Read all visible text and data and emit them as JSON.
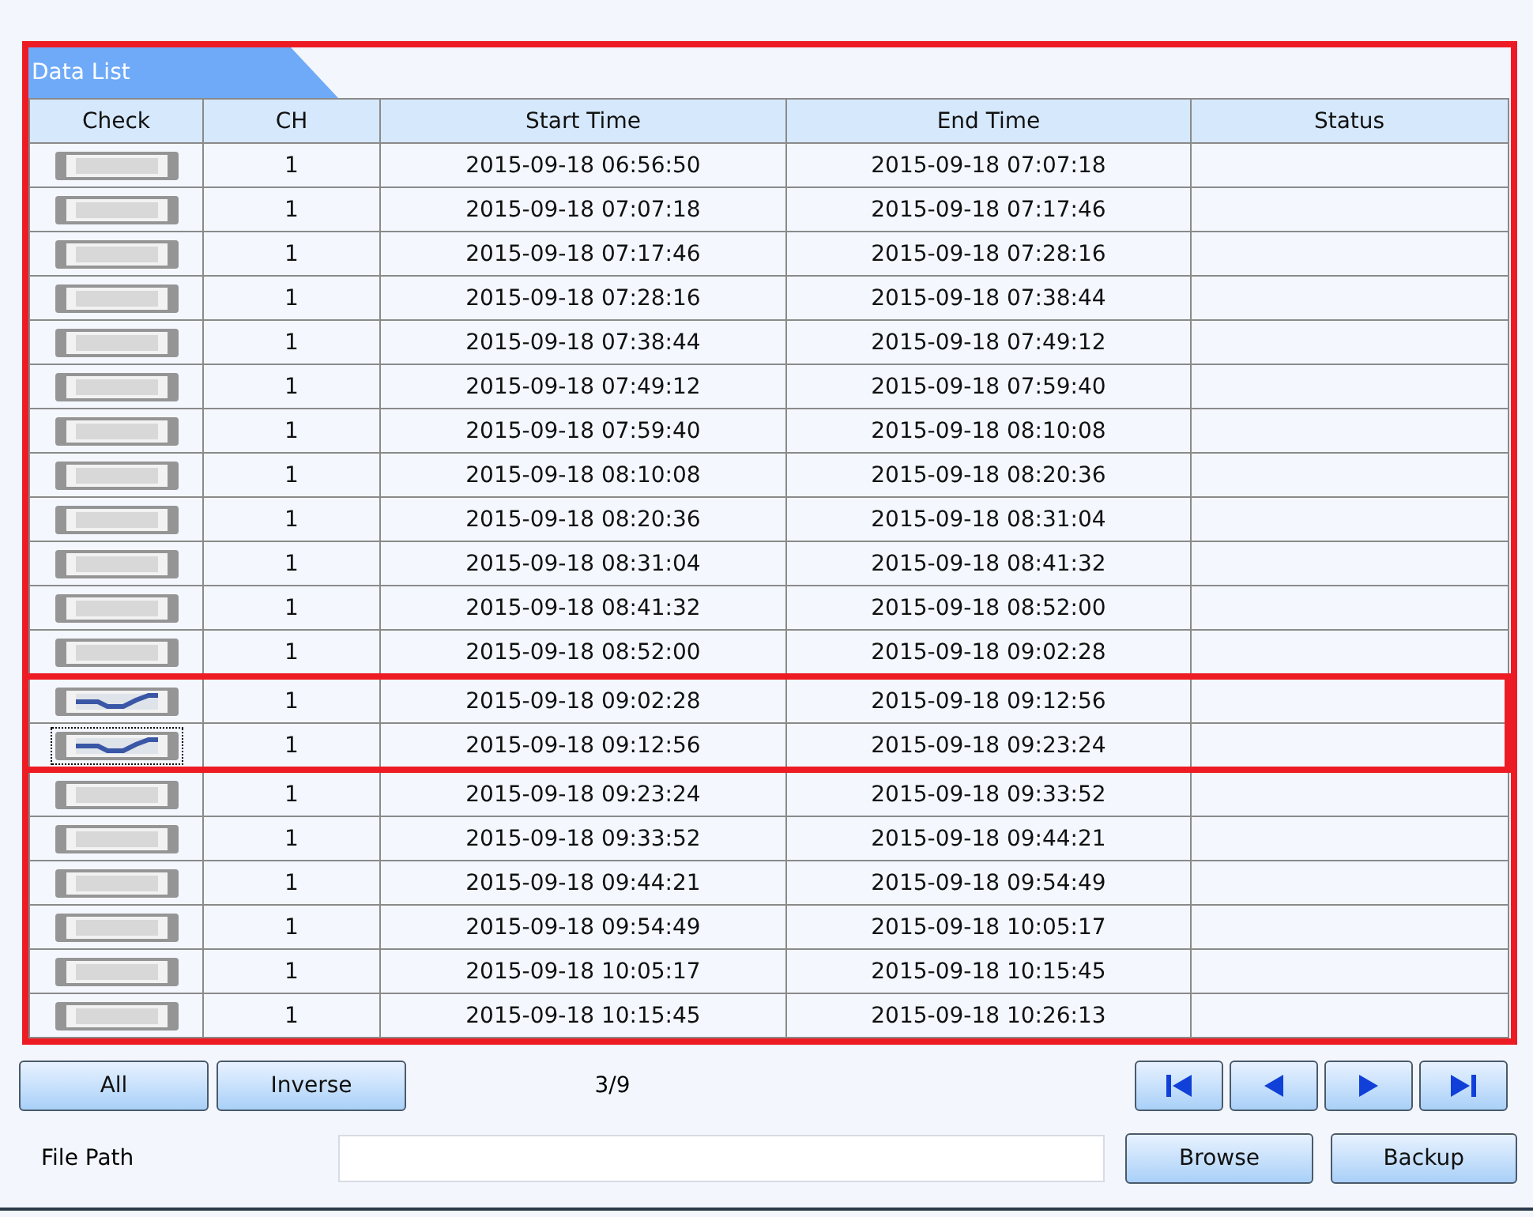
{
  "panel": {
    "tab": "Data List"
  },
  "table": {
    "columns": [
      "Check",
      "CH",
      "Start Time",
      "End Time",
      "Status"
    ],
    "rows": [
      {
        "checked": false,
        "focused": false,
        "ch": "1",
        "start": "2015-09-18 06:56:50",
        "end": "2015-09-18 07:07:18"
      },
      {
        "checked": false,
        "focused": false,
        "ch": "1",
        "start": "2015-09-18 07:07:18",
        "end": "2015-09-18 07:17:46"
      },
      {
        "checked": false,
        "focused": false,
        "ch": "1",
        "start": "2015-09-18 07:17:46",
        "end": "2015-09-18 07:28:16"
      },
      {
        "checked": false,
        "focused": false,
        "ch": "1",
        "start": "2015-09-18 07:28:16",
        "end": "2015-09-18 07:38:44"
      },
      {
        "checked": false,
        "focused": false,
        "ch": "1",
        "start": "2015-09-18 07:38:44",
        "end": "2015-09-18 07:49:12"
      },
      {
        "checked": false,
        "focused": false,
        "ch": "1",
        "start": "2015-09-18 07:49:12",
        "end": "2015-09-18 07:59:40"
      },
      {
        "checked": false,
        "focused": false,
        "ch": "1",
        "start": "2015-09-18 07:59:40",
        "end": "2015-09-18 08:10:08"
      },
      {
        "checked": false,
        "focused": false,
        "ch": "1",
        "start": "2015-09-18 08:10:08",
        "end": "2015-09-18 08:20:36"
      },
      {
        "checked": false,
        "focused": false,
        "ch": "1",
        "start": "2015-09-18 08:20:36",
        "end": "2015-09-18 08:31:04"
      },
      {
        "checked": false,
        "focused": false,
        "ch": "1",
        "start": "2015-09-18 08:31:04",
        "end": "2015-09-18 08:41:32"
      },
      {
        "checked": false,
        "focused": false,
        "ch": "1",
        "start": "2015-09-18 08:41:32",
        "end": "2015-09-18 08:52:00"
      },
      {
        "checked": false,
        "focused": false,
        "ch": "1",
        "start": "2015-09-18 08:52:00",
        "end": "2015-09-18 09:02:28"
      },
      {
        "checked": true,
        "focused": false,
        "ch": "1",
        "start": "2015-09-18 09:02:28",
        "end": "2015-09-18 09:12:56"
      },
      {
        "checked": true,
        "focused": true,
        "ch": "1",
        "start": "2015-09-18 09:12:56",
        "end": "2015-09-18 09:23:24"
      },
      {
        "checked": false,
        "focused": false,
        "ch": "1",
        "start": "2015-09-18 09:23:24",
        "end": "2015-09-18 09:33:52"
      },
      {
        "checked": false,
        "focused": false,
        "ch": "1",
        "start": "2015-09-18 09:33:52",
        "end": "2015-09-18 09:44:21"
      },
      {
        "checked": false,
        "focused": false,
        "ch": "1",
        "start": "2015-09-18 09:44:21",
        "end": "2015-09-18 09:54:49"
      },
      {
        "checked": false,
        "focused": false,
        "ch": "1",
        "start": "2015-09-18 09:54:49",
        "end": "2015-09-18 10:05:17"
      },
      {
        "checked": false,
        "focused": false,
        "ch": "1",
        "start": "2015-09-18 10:05:17",
        "end": "2015-09-18 10:15:45"
      },
      {
        "checked": false,
        "focused": false,
        "ch": "1",
        "start": "2015-09-18 10:15:45",
        "end": "2015-09-18 10:26:13"
      }
    ]
  },
  "controls": {
    "all": "All",
    "inverse": "Inverse",
    "page": "3/9",
    "file_path_label": "File Path",
    "browse": "Browse",
    "backup": "Backup"
  }
}
